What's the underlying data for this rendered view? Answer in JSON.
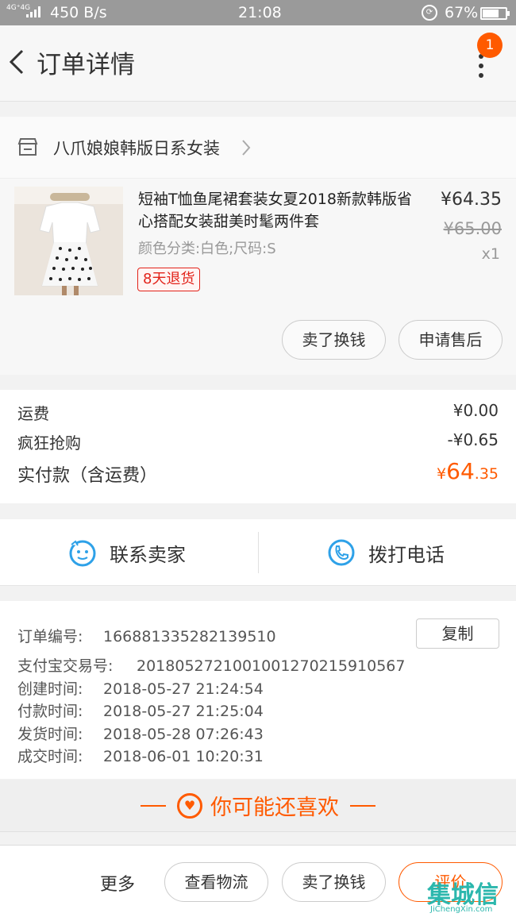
{
  "status_bar": {
    "network": "4G⁺4G",
    "speed": "450 B/s",
    "time": "21:08",
    "battery": "67%"
  },
  "header": {
    "title": "订单详情",
    "badge_count": "1"
  },
  "shop": {
    "name": "八爪娘娘韩版日系女装"
  },
  "product": {
    "title": "短袖T恤鱼尾裙套装女夏2018新款韩版省心搭配女装甜美时髦两件套",
    "sku": "颜色分类:白色;尺码:S",
    "return_policy": "8天退货",
    "price": "¥64.35",
    "original_price": "¥65.00",
    "quantity": "x1"
  },
  "actions": {
    "sell_for_cash": "卖了换钱",
    "after_sales": "申请售后"
  },
  "costs": {
    "shipping_label": "运费",
    "shipping_value": "¥0.00",
    "discount_label": "疯狂抢购",
    "discount_value": "-¥0.65",
    "total_label": "实付款（含运费）",
    "total_currency": "¥",
    "total_int": "64",
    "total_dec": ".35"
  },
  "contact": {
    "seller": "联系卖家",
    "call": "拨打电话"
  },
  "order_info": {
    "order_no_label": "订单编号:",
    "order_no": "166881335282139510",
    "copy_label": "复制",
    "alipay_label": "支付宝交易号:",
    "alipay_no": "2018052721001001270215910567",
    "created_label": "创建时间:",
    "created": "2018-05-27 21:24:54",
    "paid_label": "付款时间:",
    "paid": "2018-05-27 21:25:04",
    "shipped_label": "发货时间:",
    "shipped": "2018-05-28 07:26:43",
    "done_label": "成交时间:",
    "done": "2018-06-01 10:20:31"
  },
  "recommend": {
    "title": "你可能还喜欢"
  },
  "bottom_bar": {
    "more": "更多",
    "logistics": "查看物流",
    "sell": "卖了换钱",
    "review": "评价"
  },
  "watermark": {
    "text": "集城信",
    "url": "JiChengXin.com"
  },
  "colors": {
    "accent": "#ff5a00",
    "contact_icon": "#2ea1e8",
    "tag_red": "#e2231a"
  }
}
